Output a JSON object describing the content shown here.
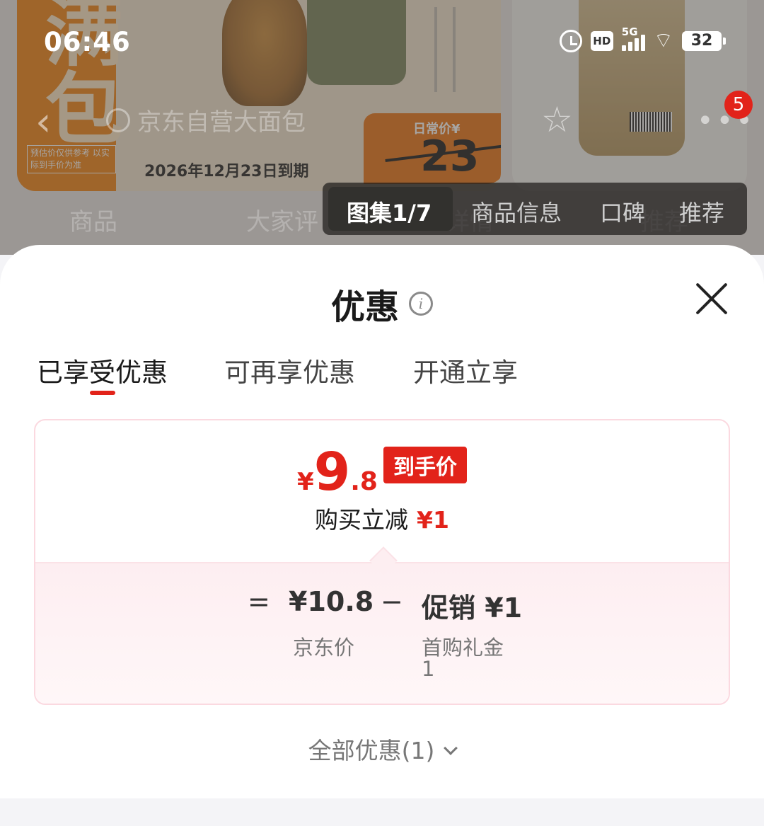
{
  "status_bar": {
    "time": "06:46",
    "hd": "HD",
    "network": "5G",
    "battery": "32"
  },
  "background": {
    "card_notice": "预估价仅供参考 以实际到手价为准",
    "expiry": "2026年12月23日到期",
    "daily_price_label": "日常价¥",
    "daily_price": "23",
    "search_text": "京东自营大面包",
    "cart_badge": "5",
    "tabs": [
      "商品",
      "大家评",
      "详情",
      "推荐"
    ],
    "gallery_tabs": [
      "图集1/7",
      "商品信息",
      "口碑",
      "推荐"
    ]
  },
  "sheet": {
    "title": "优惠",
    "tabs": [
      "已享受优惠",
      "可再享优惠",
      "开通立享"
    ],
    "price": {
      "yen": "¥",
      "int": "9",
      "dec": ".8",
      "badge": "到手价"
    },
    "reduce": {
      "label": "购买立减",
      "amount": "¥1"
    },
    "formula": {
      "eq": "=",
      "jd_price": "¥10.8",
      "minus": "−",
      "promo": "促销 ¥1",
      "jd_price_label": "京东价",
      "promo_label": "首购礼金",
      "promo_count": "1"
    },
    "all_offers": "全部优惠(1)"
  }
}
